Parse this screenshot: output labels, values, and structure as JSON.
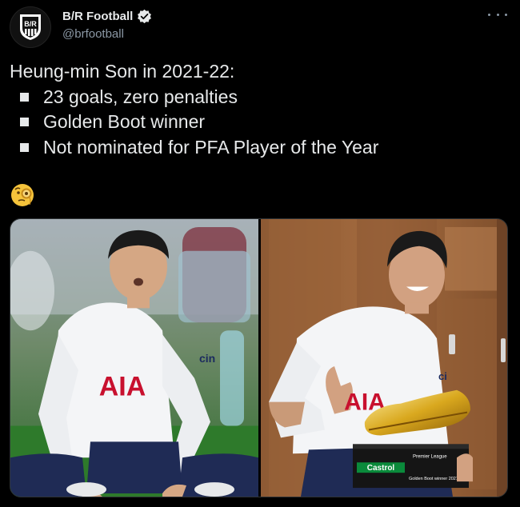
{
  "author": {
    "display_name": "B/R Football",
    "handle": "@brfootball",
    "avatar_text": "B/R",
    "verified": true
  },
  "tweet": {
    "headline": "Heung-min Son in 2021-22:",
    "bullets": [
      "23 goals, zero penalties",
      "Golden Boot winner",
      "Not nominated for PFA Player of the Year"
    ],
    "emoji": "face-with-monocle"
  },
  "media": {
    "left_photo": {
      "shirt_text": "AIA",
      "sleeve_text": "cin"
    },
    "right_photo": {
      "shirt_text": "AIA",
      "sleeve_text": "ci",
      "trophy_brand": "Castrol",
      "trophy_league": "Premier League",
      "trophy_caption": "Golden Boot winner 2021/22"
    }
  },
  "colors": {
    "background": "#000000",
    "text": "#e7e9ea",
    "muted": "#8b98a5",
    "verified": "#1d9bf0"
  }
}
